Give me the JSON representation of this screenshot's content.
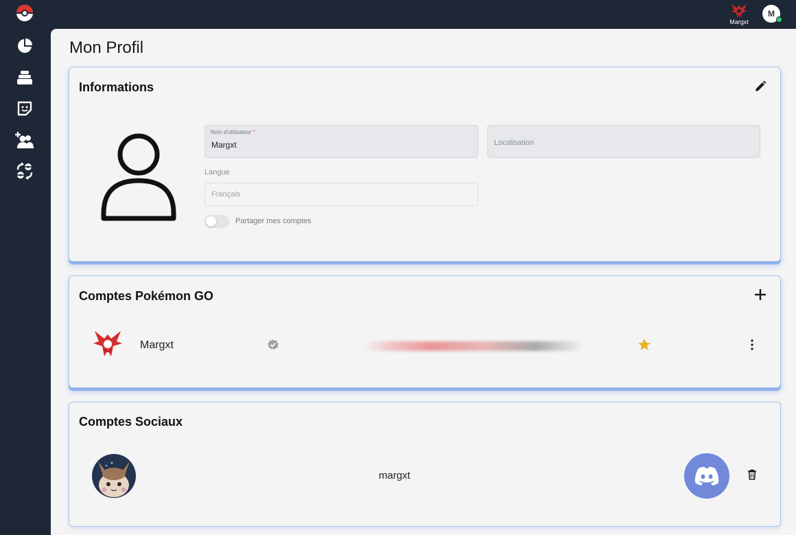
{
  "topbar": {
    "username": "Margxt",
    "avatar_initial": "M"
  },
  "sidebar": {
    "items": [
      {
        "icon": "pokeball-icon"
      },
      {
        "icon": "pie-chart-icon"
      },
      {
        "icon": "stack-icon"
      },
      {
        "icon": "sticker-icon"
      },
      {
        "icon": "add-friend-icon"
      },
      {
        "icon": "trade-icon"
      }
    ]
  },
  "page": {
    "title": "Mon Profil"
  },
  "info": {
    "title": "Informations",
    "username_label": "Nom d'utilisateur",
    "username_required": "*",
    "username_value": "Margxt",
    "location_placeholder": "Localisation",
    "language_label": "Langue",
    "language_value": "Français",
    "share_label": "Partager mes comptes"
  },
  "go_accounts": {
    "title": "Comptes Pokémon GO",
    "items": [
      {
        "name": "Margxt",
        "team": "Valor",
        "verified": true,
        "favorite": true
      }
    ]
  },
  "social": {
    "title": "Comptes Sociaux",
    "items": [
      {
        "name": "margxt",
        "service": "discord"
      }
    ]
  },
  "colors": {
    "sidebar": "#1e2735",
    "background": "#f4f4f5",
    "card_border": "#a9c4e8",
    "valor_red": "#d32f2f",
    "discord": "#7289da",
    "star": "#e6b422",
    "online": "#2ecc71"
  }
}
